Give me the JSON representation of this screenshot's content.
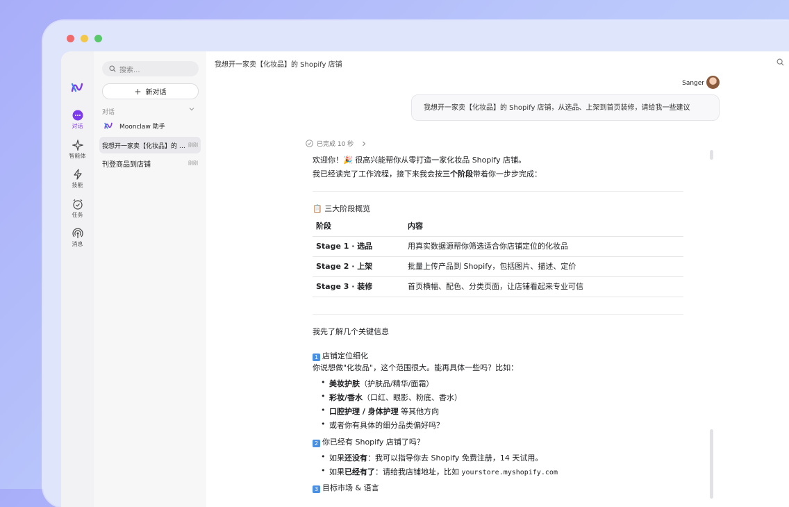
{
  "colors": {
    "accent": "#7c3aed",
    "close": "#f06a6a",
    "minimize": "#f3c74b",
    "maximize": "#59c86a"
  },
  "rail": {
    "items": [
      {
        "label": "对话",
        "icon": "chat-bubble-icon"
      },
      {
        "label": "智能体",
        "icon": "sparkle-icon"
      },
      {
        "label": "技能",
        "icon": "lightning-icon"
      },
      {
        "label": "任务",
        "icon": "alarm-clock-icon"
      },
      {
        "label": "消息",
        "icon": "antenna-icon"
      }
    ]
  },
  "sidebar": {
    "search_placeholder": "搜索...",
    "new_chat": "新对话",
    "section": "对话",
    "items": [
      {
        "title": "Moonclaw 助手",
        "time": ""
      },
      {
        "title": "我想开一家卖【化妆品】的 Shopify 店铺",
        "time": "刚刚"
      },
      {
        "title": "刊登商品到店铺",
        "time": "刚刚"
      }
    ]
  },
  "main": {
    "title": "我想开一家卖【化妆品】的 Shopify 店铺",
    "user_name": "Sanger",
    "user_message": "我想开一家卖【化妆品】的 Shopify 店铺，从选品、上架到首页装修，请给我一些建议",
    "status": "已完成 10 秒",
    "reply": {
      "intro1": "欢迎你！🎉 很高兴能帮你从零打造一家化妆品 Shopify 店铺。",
      "intro2a": "我已经读完了工作流程，接下来我会按",
      "intro2b": "三个阶段",
      "intro2c": "带着你一步步完成：",
      "overview": "📋 三大阶段概览",
      "table": {
        "headers": [
          "阶段",
          "内容"
        ],
        "rows": [
          [
            "Stage 1 · 选品",
            "用真实数据源帮你筛选适合你店铺定位的化妆品"
          ],
          [
            "Stage 2 · 上架",
            "批量上传产品到 Shopify，包括图片、描述、定价"
          ],
          [
            "Stage 3 · 装修",
            "首页横幅、配色、分类页面，让店铺看起来专业可信"
          ]
        ]
      },
      "key_info": "我先了解几个关键信息",
      "q1_num": "1",
      "q1_title": "店铺定位细化",
      "q1_text": "你说想做\"化妆品\"，这个范围很大。能再具体一些吗？比如：",
      "q1_bullets": [
        {
          "bold": "美妆护肤",
          "rest": "（护肤品/精华/面霜）"
        },
        {
          "bold": "彩妆/香水",
          "rest": "（口红、眼影、粉底、香水）"
        },
        {
          "bold": "口腔护理 / 身体护理",
          "rest": " 等其他方向"
        },
        {
          "bold": "",
          "rest": "或者你有具体的细分品类偏好吗？"
        }
      ],
      "q2_num": "2",
      "q2_title": "你已经有 Shopify 店铺了吗？",
      "q2_b1_pre": "如果",
      "q2_b1_bold": "还没有",
      "q2_b1_rest": "：我可以指导你去 Shopify 免费注册，14 天试用。",
      "q2_b2_pre": "如果",
      "q2_b2_bold": "已经有了",
      "q2_b2_rest": "：请给我店铺地址，比如",
      "q2_b2_code": "yourstore.myshopify.com",
      "q3_partial": "目标市场 & 语言"
    }
  }
}
